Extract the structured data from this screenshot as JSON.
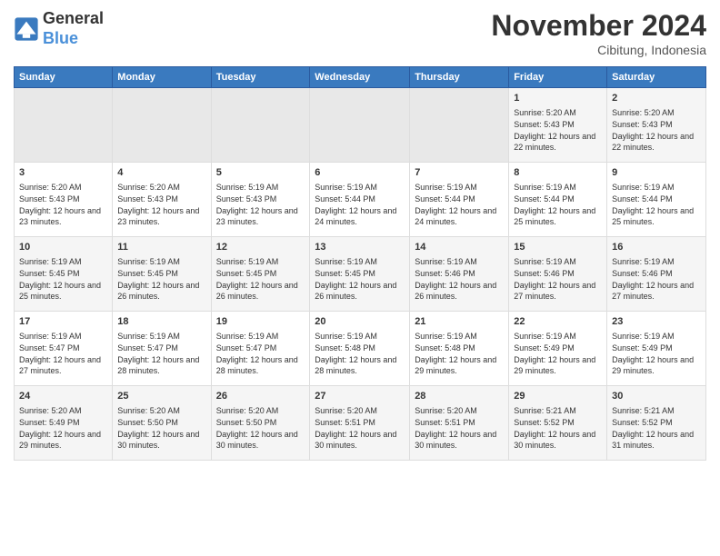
{
  "header": {
    "logo_line1": "General",
    "logo_line2": "Blue",
    "month": "November 2024",
    "location": "Cibitung, Indonesia"
  },
  "weekdays": [
    "Sunday",
    "Monday",
    "Tuesday",
    "Wednesday",
    "Thursday",
    "Friday",
    "Saturday"
  ],
  "weeks": [
    [
      {
        "day": "",
        "empty": true
      },
      {
        "day": "",
        "empty": true
      },
      {
        "day": "",
        "empty": true
      },
      {
        "day": "",
        "empty": true
      },
      {
        "day": "",
        "empty": true
      },
      {
        "day": "1",
        "sunrise": "5:20 AM",
        "sunset": "5:43 PM",
        "daylight": "12 hours and 22 minutes."
      },
      {
        "day": "2",
        "sunrise": "5:20 AM",
        "sunset": "5:43 PM",
        "daylight": "12 hours and 22 minutes."
      }
    ],
    [
      {
        "day": "3",
        "sunrise": "5:20 AM",
        "sunset": "5:43 PM",
        "daylight": "12 hours and 23 minutes."
      },
      {
        "day": "4",
        "sunrise": "5:20 AM",
        "sunset": "5:43 PM",
        "daylight": "12 hours and 23 minutes."
      },
      {
        "day": "5",
        "sunrise": "5:19 AM",
        "sunset": "5:43 PM",
        "daylight": "12 hours and 23 minutes."
      },
      {
        "day": "6",
        "sunrise": "5:19 AM",
        "sunset": "5:44 PM",
        "daylight": "12 hours and 24 minutes."
      },
      {
        "day": "7",
        "sunrise": "5:19 AM",
        "sunset": "5:44 PM",
        "daylight": "12 hours and 24 minutes."
      },
      {
        "day": "8",
        "sunrise": "5:19 AM",
        "sunset": "5:44 PM",
        "daylight": "12 hours and 25 minutes."
      },
      {
        "day": "9",
        "sunrise": "5:19 AM",
        "sunset": "5:44 PM",
        "daylight": "12 hours and 25 minutes."
      }
    ],
    [
      {
        "day": "10",
        "sunrise": "5:19 AM",
        "sunset": "5:45 PM",
        "daylight": "12 hours and 25 minutes."
      },
      {
        "day": "11",
        "sunrise": "5:19 AM",
        "sunset": "5:45 PM",
        "daylight": "12 hours and 26 minutes."
      },
      {
        "day": "12",
        "sunrise": "5:19 AM",
        "sunset": "5:45 PM",
        "daylight": "12 hours and 26 minutes."
      },
      {
        "day": "13",
        "sunrise": "5:19 AM",
        "sunset": "5:45 PM",
        "daylight": "12 hours and 26 minutes."
      },
      {
        "day": "14",
        "sunrise": "5:19 AM",
        "sunset": "5:46 PM",
        "daylight": "12 hours and 26 minutes."
      },
      {
        "day": "15",
        "sunrise": "5:19 AM",
        "sunset": "5:46 PM",
        "daylight": "12 hours and 27 minutes."
      },
      {
        "day": "16",
        "sunrise": "5:19 AM",
        "sunset": "5:46 PM",
        "daylight": "12 hours and 27 minutes."
      }
    ],
    [
      {
        "day": "17",
        "sunrise": "5:19 AM",
        "sunset": "5:47 PM",
        "daylight": "12 hours and 27 minutes."
      },
      {
        "day": "18",
        "sunrise": "5:19 AM",
        "sunset": "5:47 PM",
        "daylight": "12 hours and 28 minutes."
      },
      {
        "day": "19",
        "sunrise": "5:19 AM",
        "sunset": "5:47 PM",
        "daylight": "12 hours and 28 minutes."
      },
      {
        "day": "20",
        "sunrise": "5:19 AM",
        "sunset": "5:48 PM",
        "daylight": "12 hours and 28 minutes."
      },
      {
        "day": "21",
        "sunrise": "5:19 AM",
        "sunset": "5:48 PM",
        "daylight": "12 hours and 29 minutes."
      },
      {
        "day": "22",
        "sunrise": "5:19 AM",
        "sunset": "5:49 PM",
        "daylight": "12 hours and 29 minutes."
      },
      {
        "day": "23",
        "sunrise": "5:19 AM",
        "sunset": "5:49 PM",
        "daylight": "12 hours and 29 minutes."
      }
    ],
    [
      {
        "day": "24",
        "sunrise": "5:20 AM",
        "sunset": "5:49 PM",
        "daylight": "12 hours and 29 minutes."
      },
      {
        "day": "25",
        "sunrise": "5:20 AM",
        "sunset": "5:50 PM",
        "daylight": "12 hours and 30 minutes."
      },
      {
        "day": "26",
        "sunrise": "5:20 AM",
        "sunset": "5:50 PM",
        "daylight": "12 hours and 30 minutes."
      },
      {
        "day": "27",
        "sunrise": "5:20 AM",
        "sunset": "5:51 PM",
        "daylight": "12 hours and 30 minutes."
      },
      {
        "day": "28",
        "sunrise": "5:20 AM",
        "sunset": "5:51 PM",
        "daylight": "12 hours and 30 minutes."
      },
      {
        "day": "29",
        "sunrise": "5:21 AM",
        "sunset": "5:52 PM",
        "daylight": "12 hours and 30 minutes."
      },
      {
        "day": "30",
        "sunrise": "5:21 AM",
        "sunset": "5:52 PM",
        "daylight": "12 hours and 31 minutes."
      }
    ]
  ]
}
